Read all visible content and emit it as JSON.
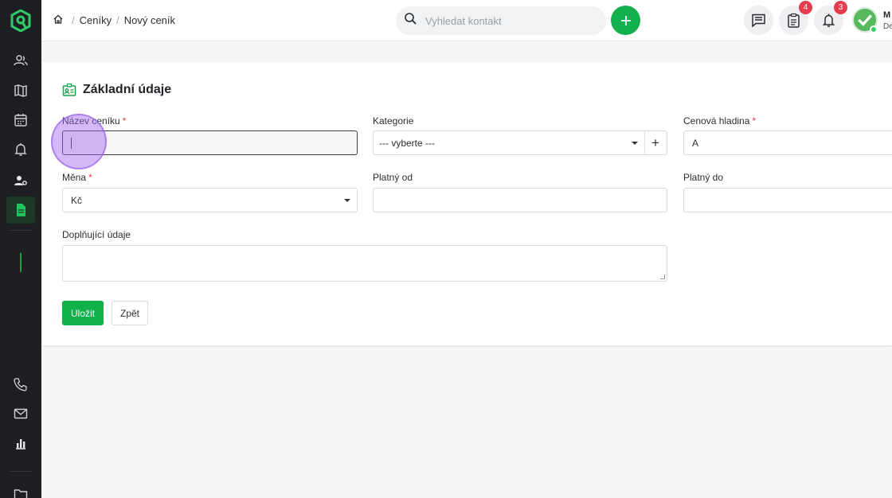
{
  "breadcrumb": {
    "items": [
      "Ceníky",
      "Nový ceník"
    ]
  },
  "search": {
    "placeholder": "Vyhledat kontakt"
  },
  "header": {
    "add_label": "+",
    "tasks_badge": "4",
    "notifications_badge": "3",
    "user_name": "M",
    "user_sub": "De"
  },
  "sidebar": {
    "items": [
      "contacts-icon",
      "map-icon",
      "calendar-icon",
      "bell-icon",
      "user-settings-icon",
      "document-icon",
      "phone-icon",
      "mail-icon",
      "chart-icon",
      "folder-icon"
    ]
  },
  "form": {
    "title": "Základní údaje",
    "name_label": "Název ceníku",
    "category_label": "Kategorie",
    "category_value": "--- vyberte ---",
    "category_add": "+",
    "price_level_label": "Cenová hladina",
    "price_level_value": "A",
    "currency_label": "Měna",
    "currency_value": "Kč",
    "valid_from_label": "Platný od",
    "valid_to_label": "Platný do",
    "extra_label": "Doplňující údaje",
    "required_mark": "*",
    "save_label": "Uložit",
    "back_label": "Zpět"
  },
  "colors": {
    "accent": "#10b04b",
    "sidebar": "#1e1f22",
    "badge": "#e53c4e"
  }
}
